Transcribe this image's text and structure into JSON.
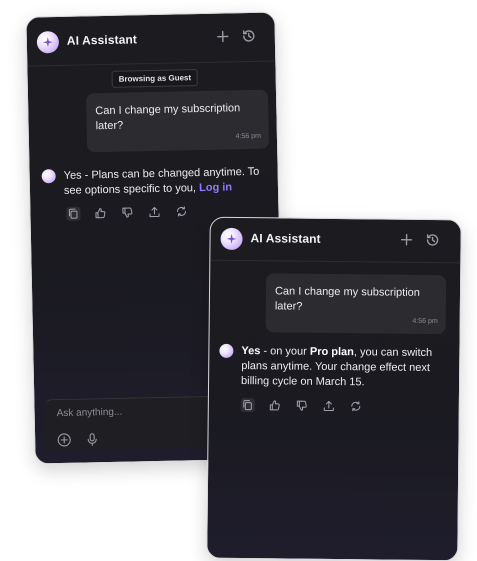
{
  "back_panel": {
    "title": "AI Assistant",
    "guest_badge": "Browsing as Guest",
    "user_message": "Can I change my subscription later?",
    "user_time": "4:56 pm",
    "bot_message": "Yes - Plans can be changed anytime. To see options specific to you,",
    "login_link": "Log in",
    "input_placeholder": "Ask anything..."
  },
  "front_panel": {
    "title": "AI Assistant",
    "user_message": "Can I change my subscription later?",
    "user_time": "4:56 pm",
    "bot_yes": "Yes",
    "bot_part1": " - on your ",
    "bot_plan": "Pro plan",
    "bot_part2": ", you can switch plans anytime. Your change effect next billing cycle on March 15."
  },
  "icons": [
    "sparkle-icon",
    "plus-icon",
    "history-icon",
    "copy-icon",
    "thumbs-up-icon",
    "thumbs-down-icon",
    "share-icon",
    "regenerate-icon",
    "add-attachment-icon",
    "microphone-icon"
  ],
  "colors": {
    "panel_bg": "#1c1c20",
    "accent_link": "#8f7bff",
    "bubble_bg": "#2b2b30",
    "avatar_purple": "#b58cf0"
  }
}
